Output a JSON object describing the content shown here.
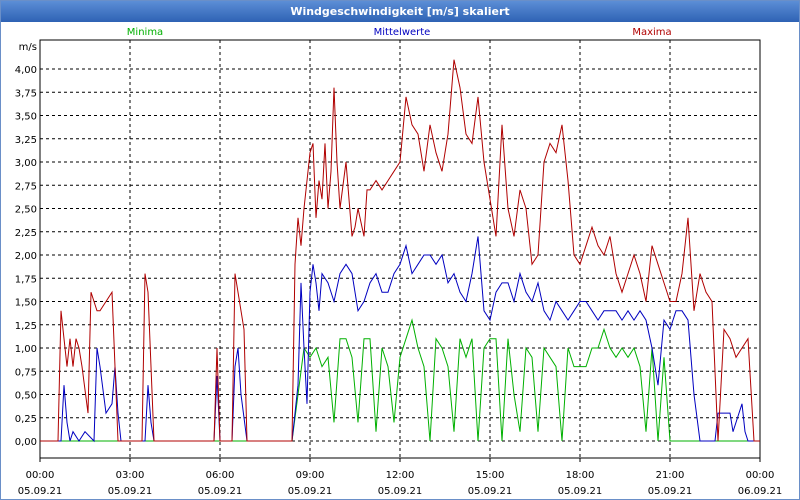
{
  "window": {
    "title": "Windgeschwindigkeit [m/s] skaliert"
  },
  "chart_data": {
    "type": "line",
    "title": "Windgeschwindigkeit [m/s] skaliert",
    "ylabel": "m/s",
    "ylim": [
      0,
      4.2
    ],
    "xlim": [
      0,
      24
    ],
    "grid": true,
    "legend_placement": "top",
    "y_ticks": [
      "0,00",
      "0,25",
      "0,50",
      "0,75",
      "1,00",
      "1,25",
      "1,50",
      "1,75",
      "2,00",
      "2,25",
      "2,50",
      "2,75",
      "3,00",
      "3,25",
      "3,50",
      "3,75",
      "4,00"
    ],
    "x_ticks": [
      {
        "time": "00:00",
        "date": "05.09.21"
      },
      {
        "time": "03:00",
        "date": "05.09.21"
      },
      {
        "time": "06:00",
        "date": "05.09.21"
      },
      {
        "time": "09:00",
        "date": "05.09.21"
      },
      {
        "time": "12:00",
        "date": "05.09.21"
      },
      {
        "time": "15:00",
        "date": "05.09.21"
      },
      {
        "time": "18:00",
        "date": "05.09.21"
      },
      {
        "time": "21:00",
        "date": "05.09.21"
      },
      {
        "time": "00:00",
        "date": "06.09.21"
      }
    ],
    "series": [
      {
        "name": "Minima",
        "color": "#00b000",
        "points": [
          [
            0,
            0
          ],
          [
            8.4,
            0
          ],
          [
            8.6,
            0.5
          ],
          [
            8.8,
            1.0
          ],
          [
            9.0,
            0.9
          ],
          [
            9.2,
            1.0
          ],
          [
            9.4,
            0.8
          ],
          [
            9.6,
            0.9
          ],
          [
            9.8,
            0.2
          ],
          [
            10.0,
            1.1
          ],
          [
            10.2,
            1.1
          ],
          [
            10.4,
            0.9
          ],
          [
            10.6,
            0.2
          ],
          [
            10.8,
            1.1
          ],
          [
            11.0,
            1.1
          ],
          [
            11.2,
            0.1
          ],
          [
            11.4,
            1.0
          ],
          [
            11.6,
            0.8
          ],
          [
            11.8,
            0.2
          ],
          [
            12.0,
            0.9
          ],
          [
            12.2,
            1.1
          ],
          [
            12.4,
            1.3
          ],
          [
            12.6,
            1.0
          ],
          [
            12.8,
            0.8
          ],
          [
            13.0,
            0
          ],
          [
            13.2,
            1.1
          ],
          [
            13.4,
            1.0
          ],
          [
            13.6,
            0.8
          ],
          [
            13.8,
            0.1
          ],
          [
            14.0,
            1.1
          ],
          [
            14.2,
            0.9
          ],
          [
            14.4,
            1.1
          ],
          [
            14.6,
            0
          ],
          [
            14.8,
            1.0
          ],
          [
            15.0,
            1.1
          ],
          [
            15.2,
            1.1
          ],
          [
            15.4,
            0
          ],
          [
            15.6,
            1.1
          ],
          [
            15.8,
            0.5
          ],
          [
            16.0,
            0.1
          ],
          [
            16.2,
            1.0
          ],
          [
            16.4,
            0.9
          ],
          [
            16.6,
            0.1
          ],
          [
            16.8,
            1.0
          ],
          [
            17.0,
            0.9
          ],
          [
            17.2,
            0.8
          ],
          [
            17.4,
            0
          ],
          [
            17.6,
            1.0
          ],
          [
            17.8,
            0.8
          ],
          [
            18.0,
            0.8
          ],
          [
            18.2,
            0.8
          ],
          [
            18.4,
            1.0
          ],
          [
            18.6,
            1.0
          ],
          [
            18.8,
            1.2
          ],
          [
            19.0,
            1.0
          ],
          [
            19.2,
            0.9
          ],
          [
            19.4,
            1.0
          ],
          [
            19.6,
            0.9
          ],
          [
            19.8,
            1.0
          ],
          [
            20.0,
            0.8
          ],
          [
            20.2,
            0.1
          ],
          [
            20.4,
            1.0
          ],
          [
            20.6,
            0
          ],
          [
            20.8,
            0.9
          ],
          [
            21.0,
            0
          ],
          [
            24,
            0
          ]
        ]
      },
      {
        "name": "Mittelwerte",
        "color": "#0000c0",
        "points": [
          [
            0,
            0
          ],
          [
            0.7,
            0
          ],
          [
            0.8,
            0.6
          ],
          [
            0.9,
            0.2
          ],
          [
            1.0,
            0.0
          ],
          [
            1.1,
            0.1
          ],
          [
            1.3,
            0.0
          ],
          [
            1.5,
            0.1
          ],
          [
            1.8,
            0.0
          ],
          [
            1.9,
            1.0
          ],
          [
            2.0,
            0.8
          ],
          [
            2.2,
            0.3
          ],
          [
            2.4,
            0.4
          ],
          [
            2.5,
            0.8
          ],
          [
            2.6,
            0.3
          ],
          [
            2.7,
            0
          ],
          [
            3.5,
            0
          ],
          [
            3.6,
            0.6
          ],
          [
            3.7,
            0.2
          ],
          [
            3.8,
            0
          ],
          [
            5.8,
            0
          ],
          [
            5.9,
            0.7
          ],
          [
            6.0,
            0.0
          ],
          [
            6.4,
            0.0
          ],
          [
            6.5,
            0.8
          ],
          [
            6.6,
            1.0
          ],
          [
            6.7,
            0.5
          ],
          [
            6.9,
            0
          ],
          [
            8.4,
            0
          ],
          [
            8.6,
            0.6
          ],
          [
            8.7,
            1.7
          ],
          [
            8.8,
            1.0
          ],
          [
            8.9,
            0.4
          ],
          [
            9.0,
            1.6
          ],
          [
            9.1,
            1.9
          ],
          [
            9.2,
            1.7
          ],
          [
            9.3,
            1.4
          ],
          [
            9.4,
            1.8
          ],
          [
            9.6,
            1.7
          ],
          [
            9.8,
            1.5
          ],
          [
            10.0,
            1.8
          ],
          [
            10.2,
            1.9
          ],
          [
            10.4,
            1.8
          ],
          [
            10.6,
            1.4
          ],
          [
            10.8,
            1.5
          ],
          [
            11.0,
            1.7
          ],
          [
            11.2,
            1.8
          ],
          [
            11.4,
            1.6
          ],
          [
            11.6,
            1.6
          ],
          [
            11.8,
            1.8
          ],
          [
            12.0,
            1.9
          ],
          [
            12.2,
            2.1
          ],
          [
            12.4,
            1.8
          ],
          [
            12.6,
            1.9
          ],
          [
            12.8,
            2.0
          ],
          [
            13.0,
            2.0
          ],
          [
            13.2,
            1.9
          ],
          [
            13.4,
            2.0
          ],
          [
            13.6,
            1.7
          ],
          [
            13.8,
            1.8
          ],
          [
            14.0,
            1.6
          ],
          [
            14.2,
            1.5
          ],
          [
            14.4,
            1.8
          ],
          [
            14.6,
            2.2
          ],
          [
            14.8,
            1.4
          ],
          [
            15.0,
            1.3
          ],
          [
            15.2,
            1.6
          ],
          [
            15.4,
            1.7
          ],
          [
            15.6,
            1.7
          ],
          [
            15.8,
            1.5
          ],
          [
            16.0,
            1.8
          ],
          [
            16.2,
            1.6
          ],
          [
            16.4,
            1.5
          ],
          [
            16.6,
            1.7
          ],
          [
            16.8,
            1.4
          ],
          [
            17.0,
            1.3
          ],
          [
            17.2,
            1.5
          ],
          [
            17.4,
            1.4
          ],
          [
            17.6,
            1.3
          ],
          [
            17.8,
            1.4
          ],
          [
            18.0,
            1.5
          ],
          [
            18.2,
            1.5
          ],
          [
            18.4,
            1.4
          ],
          [
            18.6,
            1.3
          ],
          [
            18.8,
            1.4
          ],
          [
            19.0,
            1.4
          ],
          [
            19.2,
            1.4
          ],
          [
            19.4,
            1.3
          ],
          [
            19.6,
            1.4
          ],
          [
            19.8,
            1.3
          ],
          [
            20.0,
            1.4
          ],
          [
            20.2,
            1.3
          ],
          [
            20.4,
            1.0
          ],
          [
            20.6,
            0.6
          ],
          [
            20.8,
            1.3
          ],
          [
            21.0,
            1.2
          ],
          [
            21.2,
            1.4
          ],
          [
            21.4,
            1.4
          ],
          [
            21.6,
            1.3
          ],
          [
            21.8,
            0.5
          ],
          [
            22.0,
            0
          ],
          [
            22.5,
            0
          ],
          [
            22.6,
            0.3
          ],
          [
            22.8,
            0.3
          ],
          [
            23.0,
            0.3
          ],
          [
            23.1,
            0.1
          ],
          [
            23.3,
            0.3
          ],
          [
            23.4,
            0.4
          ],
          [
            23.5,
            0.1
          ],
          [
            23.6,
            0
          ],
          [
            24,
            0
          ]
        ]
      },
      {
        "name": "Maxima",
        "color": "#b00000",
        "points": [
          [
            0,
            0
          ],
          [
            0.6,
            0
          ],
          [
            0.7,
            1.4
          ],
          [
            0.8,
            1.1
          ],
          [
            0.9,
            0.8
          ],
          [
            1.0,
            1.1
          ],
          [
            1.1,
            0.8
          ],
          [
            1.2,
            1.1
          ],
          [
            1.3,
            1.0
          ],
          [
            1.4,
            0.8
          ],
          [
            1.6,
            0.3
          ],
          [
            1.7,
            1.6
          ],
          [
            1.8,
            1.5
          ],
          [
            1.9,
            1.4
          ],
          [
            2.0,
            1.4
          ],
          [
            2.2,
            1.5
          ],
          [
            2.4,
            1.6
          ],
          [
            2.6,
            0.0
          ],
          [
            3.4,
            0
          ],
          [
            3.5,
            1.8
          ],
          [
            3.6,
            1.6
          ],
          [
            3.8,
            0
          ],
          [
            5.8,
            0
          ],
          [
            5.9,
            1.0
          ],
          [
            6.0,
            0.0
          ],
          [
            6.4,
            0.0
          ],
          [
            6.5,
            1.8
          ],
          [
            6.6,
            1.6
          ],
          [
            6.8,
            1.2
          ],
          [
            6.9,
            0
          ],
          [
            8.4,
            0
          ],
          [
            8.5,
            1.9
          ],
          [
            8.6,
            2.4
          ],
          [
            8.7,
            2.1
          ],
          [
            8.8,
            2.5
          ],
          [
            9.0,
            3.1
          ],
          [
            9.1,
            3.2
          ],
          [
            9.2,
            2.4
          ],
          [
            9.3,
            2.8
          ],
          [
            9.4,
            2.6
          ],
          [
            9.5,
            3.2
          ],
          [
            9.6,
            2.5
          ],
          [
            9.7,
            2.9
          ],
          [
            9.8,
            3.8
          ],
          [
            9.9,
            3.0
          ],
          [
            10.0,
            2.5
          ],
          [
            10.2,
            3.0
          ],
          [
            10.4,
            2.2
          ],
          [
            10.5,
            2.3
          ],
          [
            10.6,
            2.5
          ],
          [
            10.8,
            2.2
          ],
          [
            10.9,
            2.7
          ],
          [
            11.0,
            2.7
          ],
          [
            11.2,
            2.8
          ],
          [
            11.4,
            2.7
          ],
          [
            11.6,
            2.8
          ],
          [
            11.8,
            2.9
          ],
          [
            12.0,
            3.0
          ],
          [
            12.2,
            3.7
          ],
          [
            12.4,
            3.4
          ],
          [
            12.6,
            3.3
          ],
          [
            12.8,
            2.9
          ],
          [
            13.0,
            3.4
          ],
          [
            13.2,
            3.1
          ],
          [
            13.4,
            2.9
          ],
          [
            13.6,
            3.3
          ],
          [
            13.8,
            4.1
          ],
          [
            14.0,
            3.8
          ],
          [
            14.2,
            3.3
          ],
          [
            14.4,
            3.2
          ],
          [
            14.6,
            3.7
          ],
          [
            14.8,
            3.0
          ],
          [
            15.0,
            2.6
          ],
          [
            15.2,
            2.2
          ],
          [
            15.4,
            3.4
          ],
          [
            15.6,
            2.5
          ],
          [
            15.8,
            2.2
          ],
          [
            16.0,
            2.7
          ],
          [
            16.2,
            2.5
          ],
          [
            16.4,
            1.9
          ],
          [
            16.6,
            2.0
          ],
          [
            16.8,
            3.0
          ],
          [
            17.0,
            3.2
          ],
          [
            17.2,
            3.1
          ],
          [
            17.4,
            3.4
          ],
          [
            17.6,
            2.8
          ],
          [
            17.8,
            2.0
          ],
          [
            18.0,
            1.9
          ],
          [
            18.2,
            2.1
          ],
          [
            18.4,
            2.3
          ],
          [
            18.6,
            2.1
          ],
          [
            18.8,
            2.0
          ],
          [
            19.0,
            2.2
          ],
          [
            19.2,
            1.8
          ],
          [
            19.4,
            1.6
          ],
          [
            19.6,
            1.8
          ],
          [
            19.8,
            2.0
          ],
          [
            20.0,
            1.8
          ],
          [
            20.2,
            1.5
          ],
          [
            20.4,
            2.1
          ],
          [
            20.6,
            1.9
          ],
          [
            20.8,
            1.7
          ],
          [
            21.0,
            1.5
          ],
          [
            21.2,
            1.5
          ],
          [
            21.4,
            1.8
          ],
          [
            21.6,
            2.4
          ],
          [
            21.8,
            1.4
          ],
          [
            22.0,
            1.8
          ],
          [
            22.2,
            1.6
          ],
          [
            22.4,
            1.5
          ],
          [
            22.6,
            0
          ],
          [
            22.8,
            1.2
          ],
          [
            23.0,
            1.1
          ],
          [
            23.2,
            0.9
          ],
          [
            23.4,
            1.0
          ],
          [
            23.6,
            1.1
          ],
          [
            23.8,
            0
          ],
          [
            24,
            0
          ]
        ]
      }
    ]
  }
}
